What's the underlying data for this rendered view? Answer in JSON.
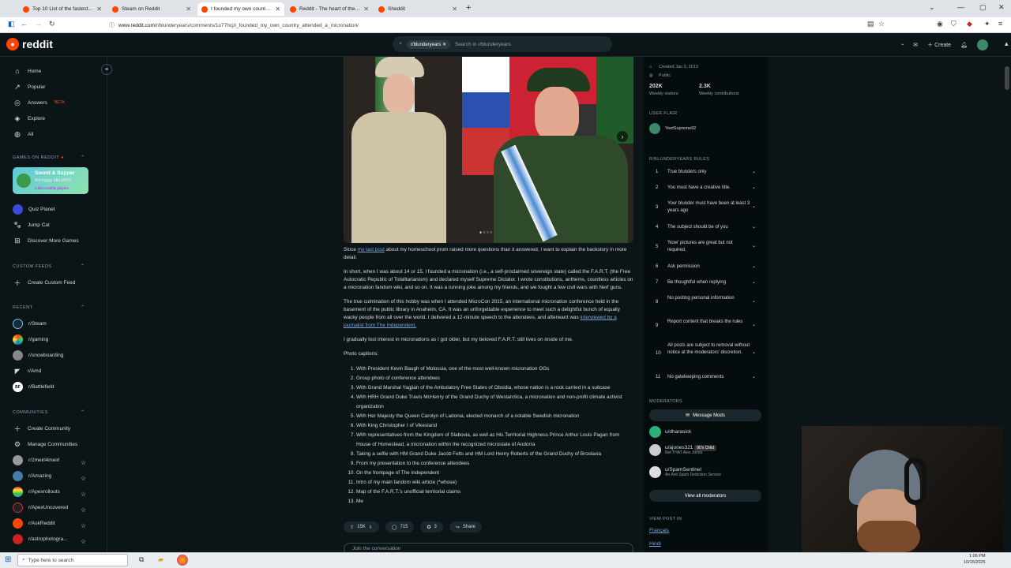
{
  "browser": {
    "tabs": [
      {
        "title": "Top 10 List of the fastest TTK W",
        "icon": "reddit"
      },
      {
        "title": "Steam on Reddit",
        "icon": "reddit"
      },
      {
        "title": "I founded my own country & a",
        "icon": "reddit",
        "active": true
      },
      {
        "title": "Reddit - The heart of the intern",
        "icon": "reddit"
      },
      {
        "title": "Sheddit",
        "icon": "reddit"
      }
    ],
    "url_host": "www.reddit.com",
    "url_path": "/r/blunderyears/comments/1o77hcj/i_founded_my_own_country_attended_a_micronation/"
  },
  "header": {
    "logo": "reddit",
    "search_chip": "r/blunderyears",
    "search_placeholder": "Search in r/blunderyears",
    "create": "Create"
  },
  "sidebar": {
    "nav": [
      {
        "label": "Home",
        "icon": "home-icon"
      },
      {
        "label": "Popular",
        "icon": "popular-icon"
      },
      {
        "label": "Answers",
        "icon": "answers-icon",
        "badge": "BETA"
      },
      {
        "label": "Explore",
        "icon": "explore-icon"
      },
      {
        "label": "All",
        "icon": "all-icon"
      }
    ],
    "games_title": "GAMES ON REDDIT",
    "game_card": {
      "title": "Sword & Supper",
      "subtitle": "A Froggy Idle RPG",
      "players": "1.2M monthly players"
    },
    "games": [
      "Quiz Planet",
      "Jump Cat",
      "Discover More Games"
    ],
    "custom_feeds_title": "CUSTOM FEEDS",
    "create_custom_feed": "Create Custom Feed",
    "recent_title": "RECENT",
    "recent": [
      "r/Steam",
      "r/gaming",
      "r/snowboarding",
      "r/Amd",
      "r/Battlefield"
    ],
    "communities_title": "COMMUNITIES",
    "create_community": "Create Community",
    "manage_communities": "Manage Communities",
    "communities": [
      "r/2meirl4meirl",
      "r/Amazing",
      "r/Apexrollouts",
      "r/ApexUncovered",
      "r/AskReddit",
      "r/astrophotogra..."
    ]
  },
  "post": {
    "intro_before": "Since ",
    "intro_link": "my last post",
    "intro_after": " about my homeschool prom raised more questions than it answered, I want to explain the backstory in more detail.",
    "p2": "In short, when I was about 14 or 15, I founded a micronation (i.e., a self-proclaimed sovereign state) called the F.A.R.T. (the Free Autocratic Republic of Totalitarianism) and declared myself Supreme Dictator. I wrote constitutions, anthems, countless articles on a micronation fandom wiki, and so on. It was a running joke among my friends, and we fought a few civil wars with Nerf guns.",
    "p3": "The true culmination of this hobby was when I attended MicroCon 2015, an international micronation conference held in the basement of the public library in Anaheim, CA. It was an unforgettable experience to meet such a delightful bunch of equally wacky people from all over the world. I delivered a 12-minute speech to the attendees, and afterward was ",
    "p3_link": "interviewed by a journalist from The Independent.",
    "p4": "I gradually lost interest in micronations as I got older, but my beloved F.A.R.T. still lives on inside of me.",
    "captions_title": "Photo captions:",
    "captions": [
      "With President Kevin Baugh of Molossia, one of the most well-known micronation OGs",
      "Group photo of conference attendees",
      "With Grand Marshal Yagjian of the Ambulatory Free States of Obsidia, whose nation is a rock carried in a suitcase",
      "With HRH Grand Duke Travis McHenry of the Grand Duchy of Westarctica, a micronation and non-profit climate activist organization",
      "With Her Majesty the Queen Carolyn of Ladonia, elected monarch of a notable Swedish micronation",
      "With King Christopher I of Vikesland",
      "With representatives from the Kingdom of Slabovia, as well as His Territorial Highness Prince Arthur Louis Pagan from House of Homestead, a micronation within the recognized microstate of Andorra",
      "Taking a selfie with HM Grand Duke Jacob Felts and HM Lord Henry Roberts of the Grand Duchy of Broslavia",
      "From my presentation to the conference attendees",
      "On the frontpage of The Independent",
      "Intro of my main fandom wiki article (*whose)",
      "Map of the F.A.R.T.'s unofficial territorial claims",
      "Me"
    ],
    "votes": "15K",
    "comments": "715",
    "awards": "3",
    "share": "Share",
    "join": "Join the conversation"
  },
  "right": {
    "created": "Created Jan 3, 2013",
    "visibility": "Public",
    "visitors_num": "202K",
    "visitors_label": "Weekly visitors",
    "contrib_num": "2.3K",
    "contrib_label": "Weekly contributions",
    "user_flair_title": "USER FLAIR",
    "user_flair": "YeetSupreme92",
    "rules_title": "R/BLUNDERYEARS RULES",
    "rules": [
      "True blunders only",
      "You must have a creative title.",
      "Your blunder must have been at least 3 years ago",
      "The subject should be of you",
      "'Now' pictures are great but not required.",
      "Ask permission",
      "Be thoughtful when replying",
      "No posting personal information",
      "Report content that breaks the rules",
      "All posts are subject to removal without notice at the moderators' discretion.",
      "No gatekeeping comments"
    ],
    "mods_title": "MODERATORS",
    "message_mods": "Message Mods",
    "mods": [
      {
        "name": "u/dharasick",
        "flair": "",
        "badge": ""
      },
      {
        "name": "u/ajones321",
        "flair": "Not THAT Alex Jones",
        "badge": "90's Child"
      },
      {
        "name": "u/SpamSentinel",
        "flair": "An Anti Spam Detection Service",
        "badge": ""
      }
    ],
    "view_all_mods": "View all moderators",
    "view_post_in": "VIEW POST IN",
    "languages": [
      "Français",
      "Hindi"
    ]
  },
  "taskbar": {
    "search": "Type here to search",
    "time": "1:06 PM",
    "date": "10/15/2025"
  },
  "colors": {
    "accent": "#ff4500",
    "link": "#7ba8d6",
    "bg": "#0b1416"
  }
}
